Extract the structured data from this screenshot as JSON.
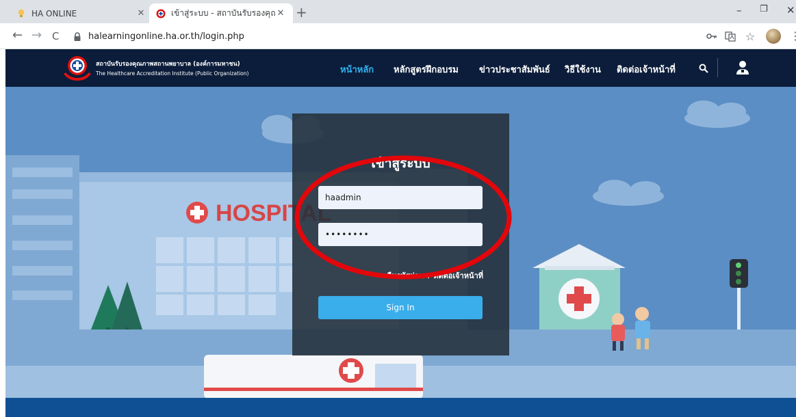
{
  "browser": {
    "tabs": [
      {
        "title": "HA ONLINE",
        "active": false
      },
      {
        "title": "เข้าสู่ระบบ - สถาบันรับรองคุณภาพสถา",
        "active": true
      }
    ],
    "new_tab_label": "+",
    "window_controls": {
      "minimize": "–",
      "restore": "❐",
      "close": "✕"
    },
    "nav": {
      "back": "←",
      "forward": "→",
      "reload": "C"
    },
    "url": "halearningonline.ha.or.th/login.php",
    "menu_glyph": "⋮"
  },
  "site": {
    "logo": {
      "name_th": "สถาบันรับรองคุณภาพสถานพยาบาล (องค์การมหาชน)",
      "name_en": "The Healthcare Accreditation Institute (Public Organization)"
    },
    "menu": [
      {
        "label": "หน้าหลัก",
        "active": true
      },
      {
        "label": "หลักสูตรฝึกอบรม",
        "active": false
      },
      {
        "label": "ข่าวประชาสัมพันธ์",
        "active": false
      },
      {
        "label": "วิธีใช้งาน",
        "active": false
      },
      {
        "label": "ติดต่อเจ้าหน้าที่",
        "active": false
      }
    ],
    "colors": {
      "header_bg": "#0b1d3a",
      "active_menu": "#2fb3f2",
      "hero_bg": "#5b8ec4",
      "button": "#3aaeea",
      "annotation": "#e2070b"
    }
  },
  "hero": {
    "hospital_sign": "HOSPITAL"
  },
  "login": {
    "title": "เข้าสู่ระบบ",
    "username_value": "haadmin",
    "password_value": "••••••••",
    "forgot_text": "ลืมรหัสผ่าน ? ติดต่อเจ้าหน้าที่",
    "signin_label": "Sign In"
  }
}
